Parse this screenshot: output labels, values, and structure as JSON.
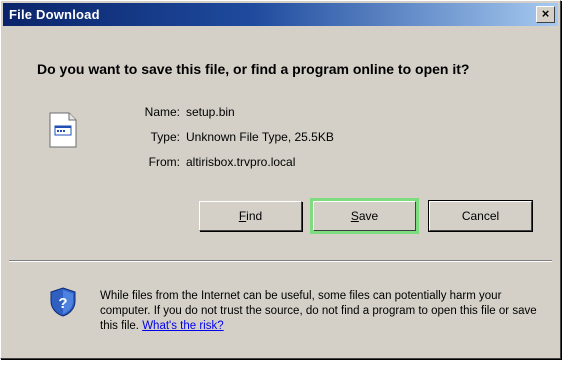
{
  "window": {
    "title": "File Download",
    "close_glyph": "×"
  },
  "prompt": {
    "question": "Do you want to save this file, or find a program online to open it?"
  },
  "file": {
    "icon": "file-icon",
    "name_label": "Name:",
    "name_value": "setup.bin",
    "type_label": "Type:",
    "type_value": "Unknown File Type, 25.5KB",
    "from_label": "From:",
    "from_value": "altirisbox.trvpro.local"
  },
  "buttons": {
    "find_hotkey": "F",
    "find_rest": "ind",
    "save_hotkey": "S",
    "save_rest": "ave",
    "cancel_label": "Cancel"
  },
  "warning": {
    "icon": "shield-question-icon",
    "text": "While files from the Internet can be useful, some files can potentially harm your computer. If you do not trust the source, do not find a program to open this file or save this file. ",
    "link_text": "What's the risk?"
  },
  "colors": {
    "title_bar_start": "#0a246a",
    "title_bar_end": "#a6caf0",
    "dialog_face": "#d4d0c8",
    "save_highlight": "#7ddc7d",
    "link": "#0000ee"
  }
}
